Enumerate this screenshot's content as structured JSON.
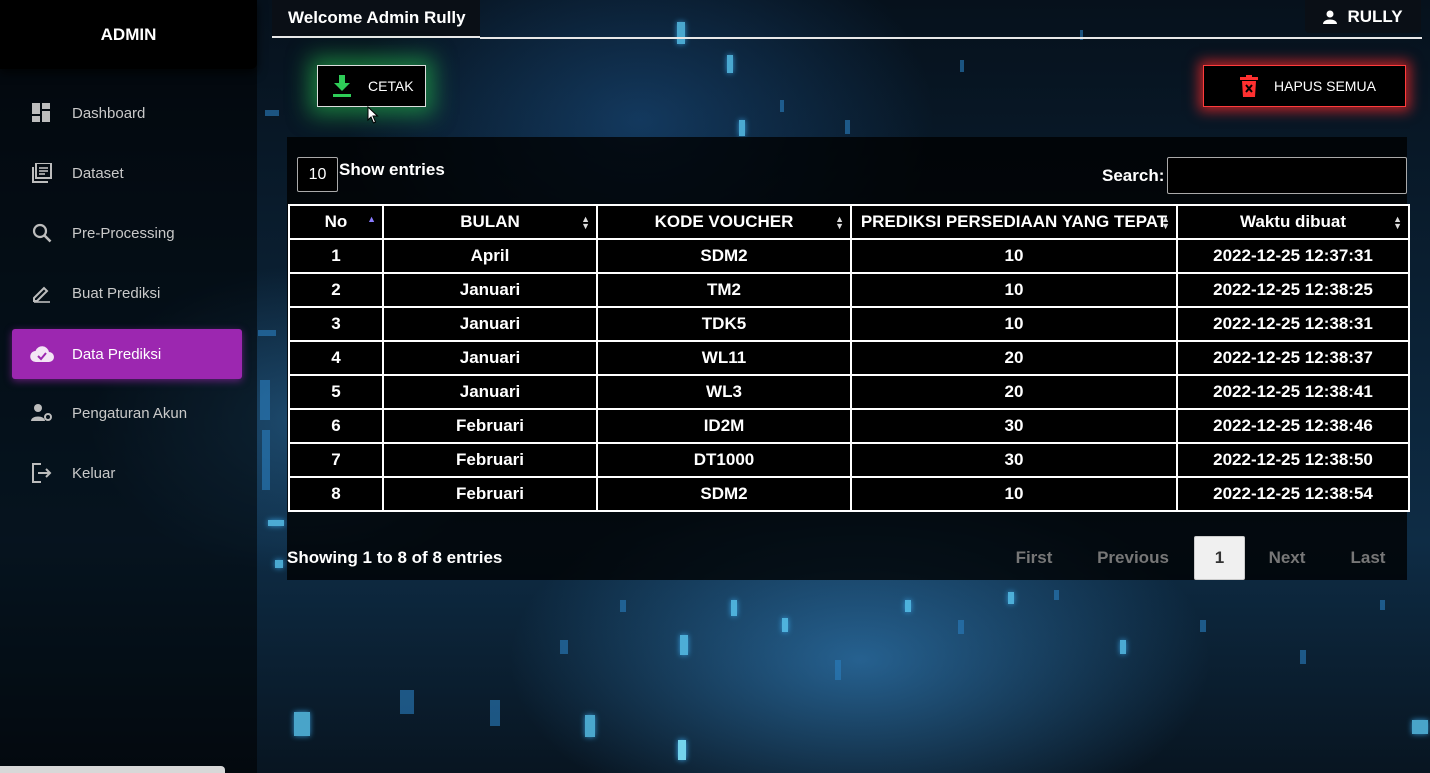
{
  "sidebar": {
    "brand": "ADMIN",
    "items": [
      {
        "label": "Dashboard",
        "icon": "dashboard-icon"
      },
      {
        "label": "Dataset",
        "icon": "library-books-icon"
      },
      {
        "label": "Pre-Processing",
        "icon": "search-icon"
      },
      {
        "label": "Buat Prediksi",
        "icon": "edit-icon"
      },
      {
        "label": "Data Prediksi",
        "icon": "cloud-done-icon",
        "active": true
      },
      {
        "label": "Pengaturan Akun",
        "icon": "manage-accounts-icon"
      },
      {
        "label": "Keluar",
        "icon": "logout-icon"
      }
    ]
  },
  "header": {
    "welcome": "Welcome Admin Rully",
    "user_name": "RULLY"
  },
  "actions": {
    "cetak_label": "CETAK",
    "hapus_label": "HAPUS SEMUA"
  },
  "table_controls": {
    "length_value": "10",
    "length_label": "Show entries",
    "search_label": "Search:",
    "search_value": ""
  },
  "table": {
    "columns": [
      "No",
      "BULAN",
      "KODE VOUCHER",
      "PREDIKSI PERSEDIAAN YANG TEPAT",
      "Waktu dibuat"
    ],
    "rows": [
      [
        "1",
        "April",
        "SDM2",
        "10",
        "2022-12-25 12:37:31"
      ],
      [
        "2",
        "Januari",
        "TM2",
        "10",
        "2022-12-25 12:38:25"
      ],
      [
        "3",
        "Januari",
        "TDK5",
        "10",
        "2022-12-25 12:38:31"
      ],
      [
        "4",
        "Januari",
        "WL11",
        "20",
        "2022-12-25 12:38:37"
      ],
      [
        "5",
        "Januari",
        "WL3",
        "20",
        "2022-12-25 12:38:41"
      ],
      [
        "6",
        "Februari",
        "ID2M",
        "30",
        "2022-12-25 12:38:46"
      ],
      [
        "7",
        "Februari",
        "DT1000",
        "30",
        "2022-12-25 12:38:50"
      ],
      [
        "8",
        "Februari",
        "SDM2",
        "10",
        "2022-12-25 12:38:54"
      ]
    ]
  },
  "footer": {
    "info": "Showing 1 to 8 of 8 entries",
    "pagination": {
      "first": "First",
      "previous": "Previous",
      "current": "1",
      "next": "Next",
      "last": "Last"
    }
  },
  "colors": {
    "active_nav": "#9c27b0",
    "cetak_glow": "#28c850",
    "hapus_glow": "#ff2828"
  }
}
